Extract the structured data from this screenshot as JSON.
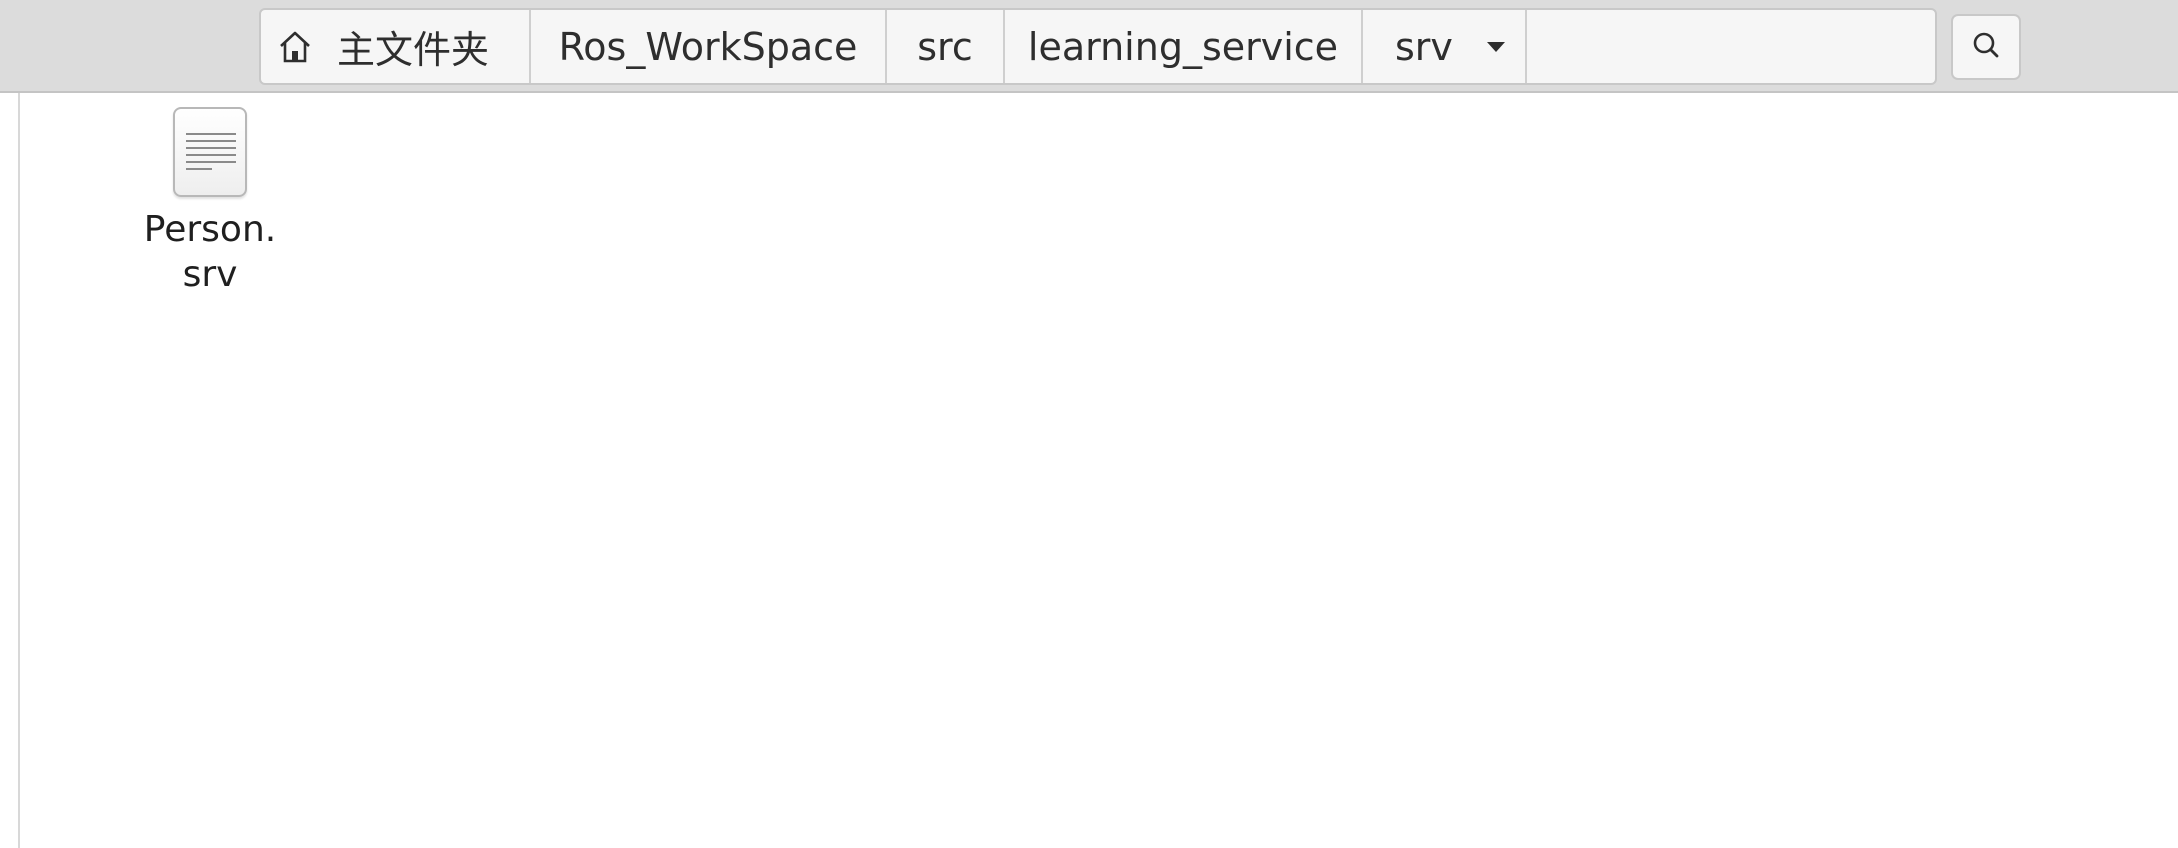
{
  "pathbar": {
    "home_label": "主文件夹",
    "crumbs": [
      "Ros_WorkSpace",
      "src",
      "learning_service",
      "srv"
    ]
  },
  "search": {
    "icon": "search-icon"
  },
  "files": [
    {
      "name_line1": "Person.",
      "name_line2": "srv",
      "icon": "text-file-icon"
    }
  ]
}
